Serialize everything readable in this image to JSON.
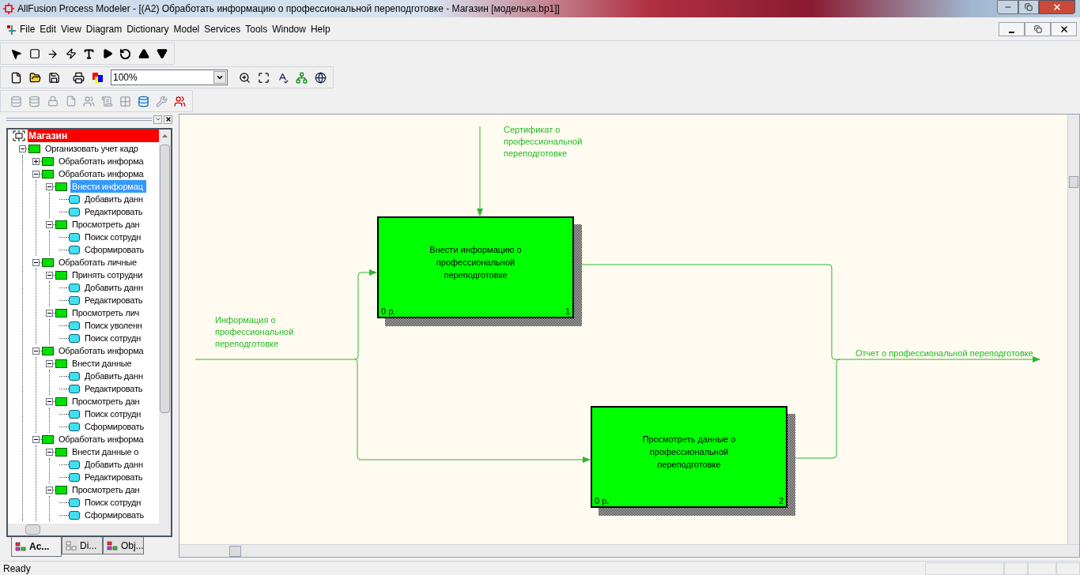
{
  "window": {
    "title": "AllFusion Process Modeler - [(A2) Обработать информацию  о профессиональной переподготовке  - Магазин  [моделька.bp1]]"
  },
  "menu": [
    {
      "label": "File"
    },
    {
      "label": "Edit"
    },
    {
      "label": "View"
    },
    {
      "label": "Diagram"
    },
    {
      "label": "Dictionary"
    },
    {
      "label": "Model"
    },
    {
      "label": "Services"
    },
    {
      "label": "Tools"
    },
    {
      "label": "Window"
    },
    {
      "label": "Help"
    }
  ],
  "zoom_field": {
    "value": "100%"
  },
  "tree": {
    "root": "Магазин",
    "items": [
      {
        "label": "Организовать учет кадр",
        "kind": "activity",
        "expanded": true,
        "selected": false,
        "children": [
          {
            "label": "Обработать информа",
            "kind": "activity",
            "expanded": false,
            "selected": false
          },
          {
            "label": "Обработать информа",
            "kind": "activity",
            "expanded": true,
            "selected": false,
            "children": [
              {
                "label": "Внести информац",
                "kind": "activity",
                "expanded": true,
                "selected": true,
                "children": [
                  {
                    "label": "Добавить данн",
                    "kind": "leaf",
                    "selected": false
                  },
                  {
                    "label": "Редактировать",
                    "kind": "leaf",
                    "selected": false
                  }
                ]
              },
              {
                "label": "Просмотреть дан",
                "kind": "activity",
                "expanded": true,
                "selected": false,
                "children": [
                  {
                    "label": "Поиск сотрудн",
                    "kind": "leaf",
                    "selected": false
                  },
                  {
                    "label": "Сформировать",
                    "kind": "leaf",
                    "selected": false
                  }
                ]
              }
            ]
          },
          {
            "label": "Обработать  личные",
            "kind": "activity",
            "expanded": true,
            "selected": false,
            "children": [
              {
                "label": "Принять сотрудни",
                "kind": "activity",
                "expanded": true,
                "selected": false,
                "children": [
                  {
                    "label": "Добавить данн",
                    "kind": "leaf",
                    "selected": false
                  },
                  {
                    "label": "Редактировать",
                    "kind": "leaf",
                    "selected": false
                  }
                ]
              },
              {
                "label": "Просмотреть  лич",
                "kind": "activity",
                "expanded": true,
                "selected": false,
                "children": [
                  {
                    "label": "Поиск уволенн",
                    "kind": "leaf",
                    "selected": false
                  },
                  {
                    "label": "Поиск сотрудн",
                    "kind": "leaf",
                    "selected": false
                  }
                ]
              }
            ]
          },
          {
            "label": "Обработать информа",
            "kind": "activity",
            "expanded": true,
            "selected": false,
            "children": [
              {
                "label": "Внести данные",
                "kind": "activity",
                "expanded": true,
                "selected": false,
                "children": [
                  {
                    "label": "Добавить данн",
                    "kind": "leaf",
                    "selected": false
                  },
                  {
                    "label": "Редактировать",
                    "kind": "leaf",
                    "selected": false
                  }
                ]
              },
              {
                "label": "Просмотреть дан",
                "kind": "activity",
                "expanded": true,
                "selected": false,
                "children": [
                  {
                    "label": "Поиск сотрудн",
                    "kind": "leaf",
                    "selected": false
                  },
                  {
                    "label": "Сформировать",
                    "kind": "leaf",
                    "selected": false
                  }
                ]
              }
            ]
          },
          {
            "label": "Обработать информа",
            "kind": "activity",
            "expanded": true,
            "selected": false,
            "children": [
              {
                "label": "Внести данные  о",
                "kind": "activity",
                "expanded": true,
                "selected": false,
                "children": [
                  {
                    "label": "Добавить данн",
                    "kind": "leaf",
                    "selected": false
                  },
                  {
                    "label": "Редактировать",
                    "kind": "leaf",
                    "selected": false
                  }
                ]
              },
              {
                "label": "Просмотреть дан",
                "kind": "activity",
                "expanded": true,
                "selected": false,
                "children": [
                  {
                    "label": "Поиск сотрудн",
                    "kind": "leaf",
                    "selected": false
                  },
                  {
                    "label": "Сформировать",
                    "kind": "leaf",
                    "selected": false
                  }
                ]
              }
            ]
          }
        ]
      }
    ]
  },
  "panel_tabs": [
    {
      "label": "Ac...",
      "selected": true
    },
    {
      "label": "Di...",
      "selected": false
    },
    {
      "label": "Obj...",
      "selected": false
    }
  ],
  "diagram": {
    "boxes": [
      {
        "label": "Внести информацию о профессиональной переподготовке",
        "cost": "0 р.",
        "number": "1"
      },
      {
        "label": "Просмотреть данные о профессиональной переподготовке",
        "cost": "0 р.",
        "number": "2"
      }
    ],
    "arrows": [
      {
        "kind": "control",
        "label": "Сертификат о профессиональной переподготовке"
      },
      {
        "kind": "input",
        "label": "Информация о профессиональной переподготовке"
      },
      {
        "kind": "output",
        "label": "Отчет о профессиональной переподготовке"
      }
    ]
  },
  "status_bar": {
    "text": "Ready"
  }
}
